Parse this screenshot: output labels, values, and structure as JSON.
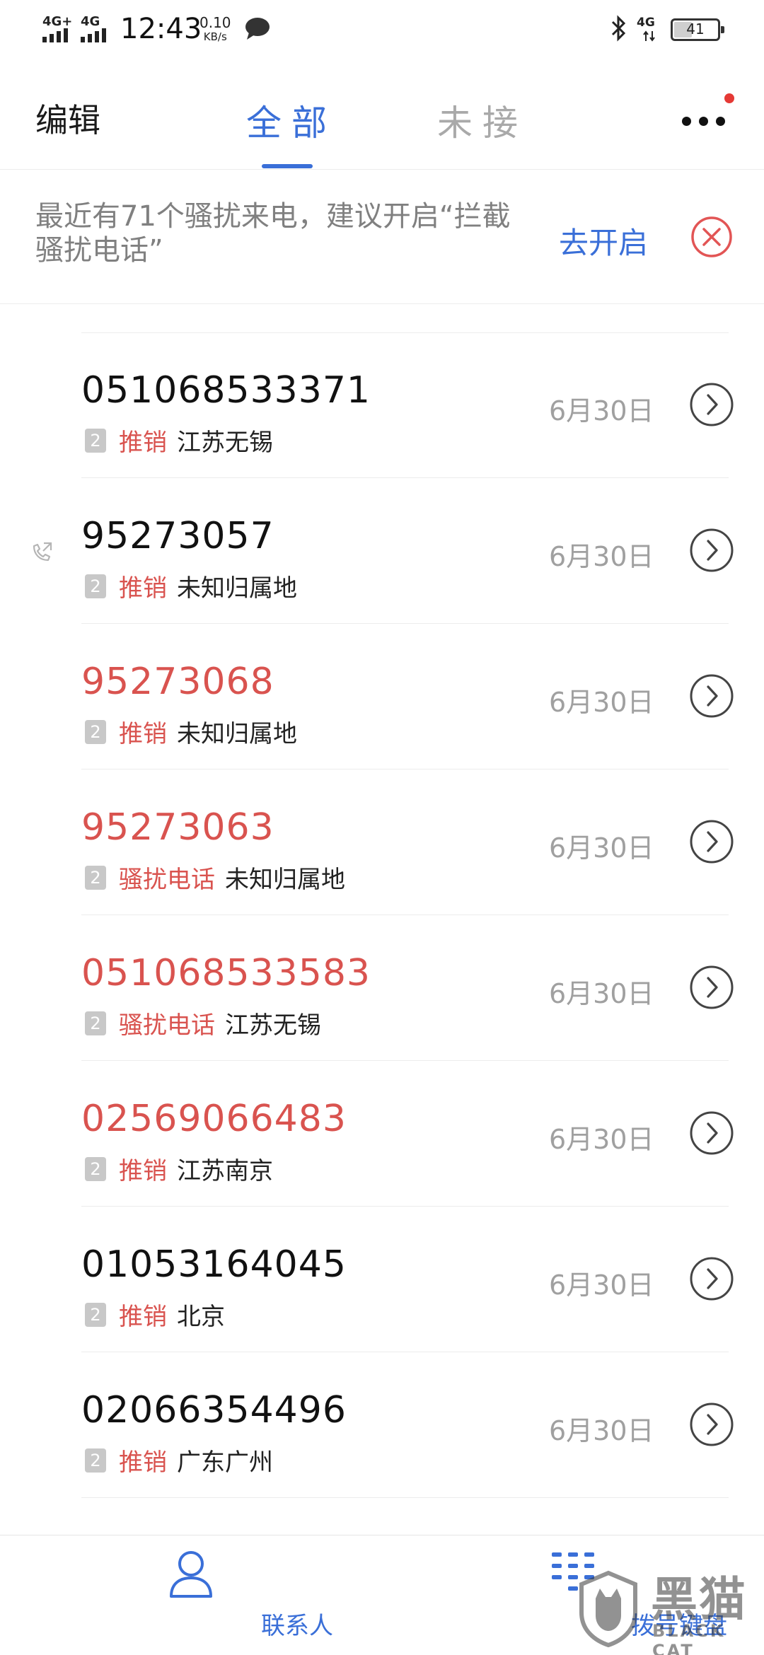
{
  "status_bar": {
    "signal1": "4G+",
    "signal2": "4G",
    "time": "12:43",
    "speed_value": "0.10",
    "speed_unit": "KB/s",
    "net": "4G",
    "battery": "41",
    "battery_fill": 0.41
  },
  "header": {
    "edit_label": "编辑",
    "tab_all": "全部",
    "tab_missed": "未接"
  },
  "banner": {
    "text": "最近有71个骚扰来电，建议开启“拦截骚扰电话”",
    "action": "去开启"
  },
  "calls": [
    {
      "number": "051068533371",
      "missed": false,
      "sim": "2",
      "tag": "推销",
      "location": "江苏无锡",
      "date": "6月30日",
      "outgoing": false
    },
    {
      "number": "95273057",
      "missed": false,
      "sim": "2",
      "tag": "推销",
      "location": "未知归属地",
      "date": "6月30日",
      "outgoing": true
    },
    {
      "number": "95273068",
      "missed": true,
      "sim": "2",
      "tag": "推销",
      "location": "未知归属地",
      "date": "6月30日",
      "outgoing": false
    },
    {
      "number": "95273063",
      "missed": true,
      "sim": "2",
      "tag": "骚扰电话",
      "location": "未知归属地",
      "date": "6月30日",
      "outgoing": false
    },
    {
      "number": "051068533583",
      "missed": true,
      "sim": "2",
      "tag": "骚扰电话",
      "location": "江苏无锡",
      "date": "6月30日",
      "outgoing": false
    },
    {
      "number": "02569066483",
      "missed": true,
      "sim": "2",
      "tag": "推销",
      "location": "江苏南京",
      "date": "6月30日",
      "outgoing": false
    },
    {
      "number": "01053164045",
      "missed": false,
      "sim": "2",
      "tag": "推销",
      "location": "北京",
      "date": "6月30日",
      "outgoing": false
    },
    {
      "number": "02066354496",
      "missed": false,
      "sim": "2",
      "tag": "推销",
      "location": "广东广州",
      "date": "6月30日",
      "outgoing": false
    }
  ],
  "bottom_nav": {
    "contacts_label": "联系人",
    "dialpad_label": "拨号键盘"
  },
  "watermark": {
    "title": "黑猫",
    "subtitle": "BLACK CAT"
  },
  "colors": {
    "accent": "#3a6fd8",
    "missed": "#d9534f",
    "close": "#e25555"
  },
  "icons": {
    "close": "close-circle-icon",
    "info": "chevron-right-circle-icon",
    "outgoing": "outgoing-call-icon",
    "contacts": "person-icon",
    "dialpad": "dialpad-icon",
    "more": "more-dots-icon"
  }
}
